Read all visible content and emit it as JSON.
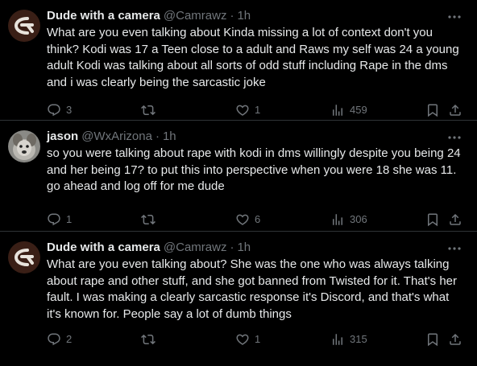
{
  "posts": [
    {
      "name": "Dude with a camera",
      "handle": "@Camrawz",
      "separator": "·",
      "time": "1h",
      "text": "What are you even talking about Kinda missing a lot of context don't you think? Kodi was 17 a Teen close to a adult and Raws my self was 24 a young adult Kodi was talking about all sorts of odd stuff including Rape in the dms and i was clearly being the sarcastic joke",
      "replies": "3",
      "reposts": "",
      "likes": "1",
      "views": "459"
    },
    {
      "name": "jason",
      "handle": "@WxArizona",
      "separator": "·",
      "time": "1h",
      "text": "so you were talking about rape with kodi in dms willingly despite you being 24 and her being 17? to put this into perspective when you were 18 she was 11. go ahead and log off for me dude",
      "replies": "1",
      "reposts": "",
      "likes": "6",
      "views": "306"
    },
    {
      "name": "Dude with a camera",
      "handle": "@Camrawz",
      "separator": "·",
      "time": "1h",
      "text": "What are you even talking about? She was the one who was always talking about rape and other stuff, and she got banned from Twisted for it. That's her fault. I was making a clearly sarcastic response it's Discord, and that's what it's known for. People say a lot of dumb things",
      "replies": "2",
      "reposts": "",
      "likes": "1",
      "views": "315"
    }
  ],
  "icons": {
    "reply": "reply-icon",
    "repost": "repost-icon",
    "like": "heart-icon",
    "views": "views-icon",
    "bookmark": "bookmark-icon",
    "share": "share-icon",
    "more": "more-icon"
  },
  "colors": {
    "background": "#000000",
    "text": "#e7e9ea",
    "muted": "#71767b",
    "divider": "#2f3336"
  }
}
